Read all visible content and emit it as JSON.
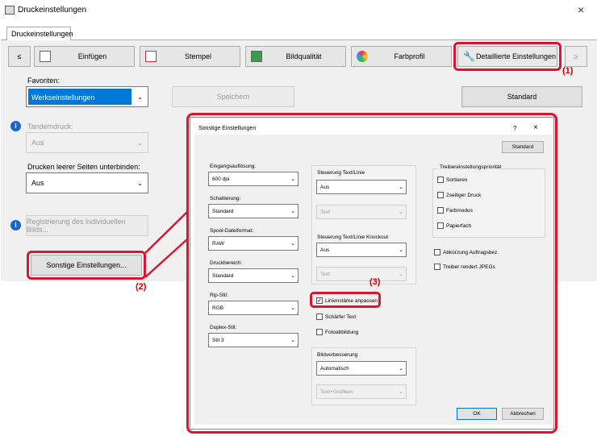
{
  "window": {
    "title": "Druckeinstellungen",
    "close": "×"
  },
  "tabs": [
    {
      "label": "Druckeinstellungen"
    }
  ],
  "toolbar": {
    "prev": "≤",
    "next": "≥",
    "buttons": [
      {
        "label": "Einfügen"
      },
      {
        "label": "Stempel"
      },
      {
        "label": "Bildqualität"
      },
      {
        "label": "Farbprofil"
      },
      {
        "label": "Detaillierte Einstellungen"
      }
    ]
  },
  "favorites": {
    "label": "Favoriten:",
    "value": "Werkseinstellungen",
    "save": "Speichern",
    "default": "Standard"
  },
  "tandem": {
    "label": "Tandemdruck:",
    "value": "Aus"
  },
  "blank_pages": {
    "label": "Drucken leerer Seiten unterbinden:",
    "value": "Aus"
  },
  "register_button": "Registrierung des individuellen Bilds...",
  "other_settings_button": "Sonstige Einstellungen...",
  "callouts": {
    "c1": "(1)",
    "c2": "(2)",
    "c3": "(3)"
  },
  "dialog": {
    "title": "Sonstige Einstellungen",
    "help": "?",
    "close": "×",
    "standard": "Standard",
    "left_fields": [
      {
        "label": "Eingangsauflösung:",
        "value": "600 dpi"
      },
      {
        "label": "Schattierung:",
        "value": "Standard"
      },
      {
        "label": "Spool-Dateiformat:",
        "value": "RAW"
      },
      {
        "label": "Druckbereich:",
        "value": "Standard"
      },
      {
        "label": "Rip-Stil:",
        "value": "RGB"
      },
      {
        "label": "Duplex-Stil:",
        "value": "Stil 3"
      }
    ],
    "text_line": {
      "label": "Steuerung Text/Linie",
      "value": "Aus",
      "sub": "Text"
    },
    "text_line_knockout": {
      "label": "Steuerung Text/Linie Knockout",
      "value": "Aus",
      "sub": "Text"
    },
    "checks_mid": [
      {
        "label": "Linienstärke anpassen",
        "checked": true
      },
      {
        "label": "Schärfer Text",
        "checked": false
      },
      {
        "label": "Fotoabbildung",
        "checked": false
      }
    ],
    "image_enhance": {
      "label": "Bildverbesserung",
      "value": "Automatisch",
      "sub": "Text+Grafiken"
    },
    "driver_priority": {
      "label": "Treibereinstellungspriorität",
      "items": [
        {
          "label": "Sortieren"
        },
        {
          "label": "2seitiger Druck"
        },
        {
          "label": "Farbmodus"
        },
        {
          "label": "Papierfach"
        }
      ]
    },
    "checks_right": [
      {
        "label": "Abkürzung Auftragsbez."
      },
      {
        "label": "Treiber rendert JPEGs"
      }
    ],
    "ok": "OK",
    "cancel": "Abbrechen"
  }
}
